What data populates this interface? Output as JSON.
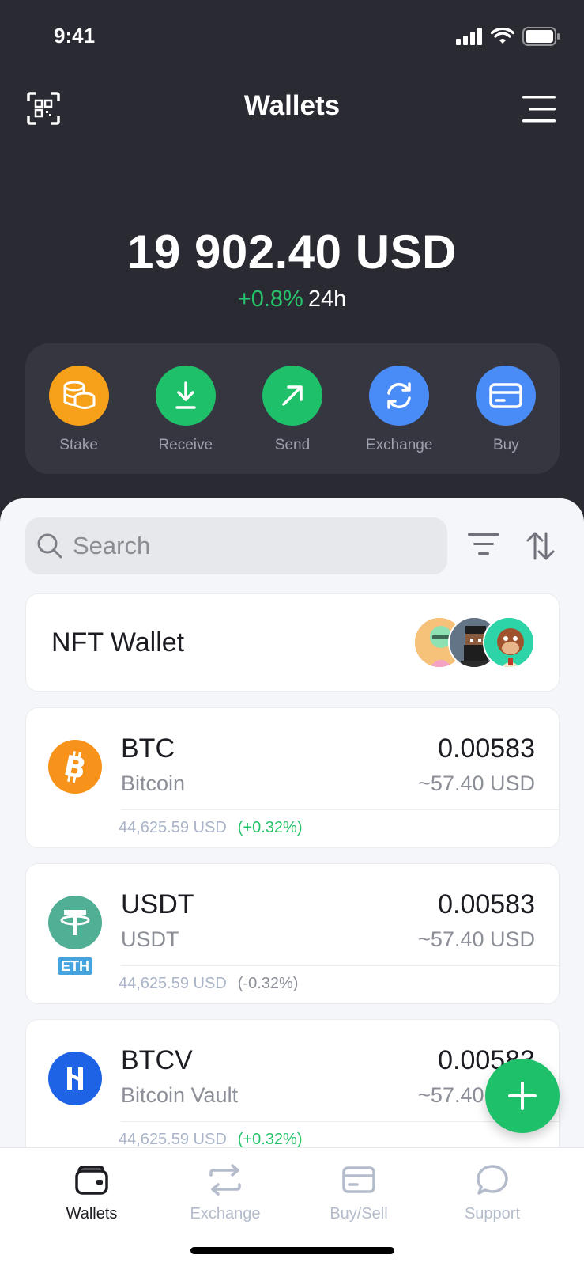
{
  "status_bar": {
    "time": "9:41"
  },
  "header": {
    "title": "Wallets"
  },
  "balance": {
    "amount": "19 902.40 USD",
    "change": "+0.8%",
    "period": "24h"
  },
  "actions": [
    {
      "label": "Stake",
      "icon": "coins-icon",
      "color": "#f7a11a"
    },
    {
      "label": "Receive",
      "icon": "download-icon",
      "color": "#1fc06a"
    },
    {
      "label": "Send",
      "icon": "arrow-up-right-icon",
      "color": "#1fc06a"
    },
    {
      "label": "Exchange",
      "icon": "refresh-icon",
      "color": "#4a8cf7"
    },
    {
      "label": "Buy",
      "icon": "card-icon",
      "color": "#4a8cf7"
    }
  ],
  "search": {
    "placeholder": "Search"
  },
  "nft": {
    "title": "NFT Wallet"
  },
  "coins": [
    {
      "symbol": "BTC",
      "name": "Bitcoin",
      "amount": "0.00583",
      "usd": "~57.40 USD",
      "price": "44,625.59 USD",
      "change": "(+0.32%)"
    },
    {
      "symbol": "USDT",
      "name": "USDT",
      "badge": "ETH",
      "amount": "0.00583",
      "usd": "~57.40 USD",
      "price": "44,625.59 USD",
      "change": "(-0.32%)"
    },
    {
      "symbol": "BTCV",
      "name": "Bitcoin Vault",
      "amount": "0.00583",
      "usd": "~57.40 USD",
      "price": "44,625.59 USD",
      "change": "(+0.32%)"
    }
  ],
  "tabs": [
    {
      "label": "Wallets",
      "active": true
    },
    {
      "label": "Exchange",
      "active": false
    },
    {
      "label": "Buy/Sell",
      "active": false
    },
    {
      "label": "Support",
      "active": false
    }
  ],
  "colors": {
    "accent_green": "#1fc06a",
    "accent_blue": "#4a8cf7",
    "accent_orange": "#f7a11a",
    "dark_bg": "#2a2a33"
  }
}
